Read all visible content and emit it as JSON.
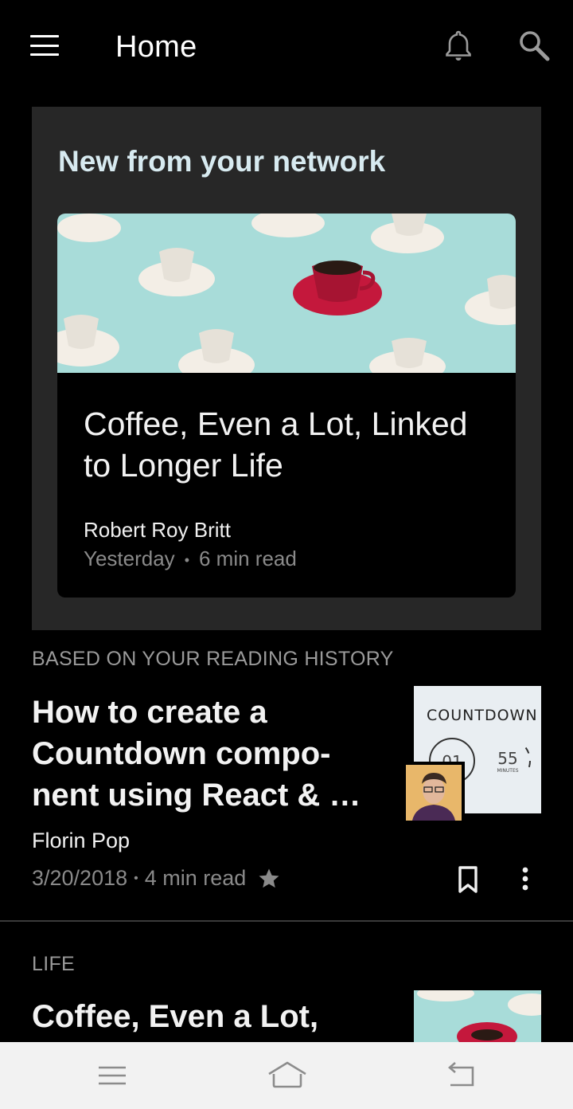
{
  "appbar": {
    "title": "Home"
  },
  "network": {
    "heading": "New from your network",
    "story": {
      "title": "Coffee, Even a Lot, Linked to Longer Life",
      "author": "Robert Roy Britt",
      "date": "Yesterday",
      "read_time": "6 min read"
    }
  },
  "history": {
    "label": "BASED ON YOUR READING HISTORY",
    "article": {
      "title": "How to create a Countdown compo-nent using React & …",
      "author": "Florin Pop",
      "date": "3/20/2018",
      "read_time": "4 min read",
      "thumb_word": "COUNTDOWN",
      "thumb_num1": "01",
      "thumb_num2": "55",
      "thumb_unit": "MINUTES"
    }
  },
  "life": {
    "label": "LIFE",
    "article": {
      "title": "Coffee, Even a Lot,"
    }
  },
  "icons": {
    "menu": "hamburger-menu-icon",
    "bell": "bell-icon",
    "search": "search-icon",
    "star": "star-icon",
    "bookmark": "bookmark-icon",
    "more": "more-vert-icon"
  },
  "colors": {
    "background": "#000000",
    "card": "#272727",
    "heading": "#d7eaf0",
    "muted": "#8a8a8a"
  }
}
